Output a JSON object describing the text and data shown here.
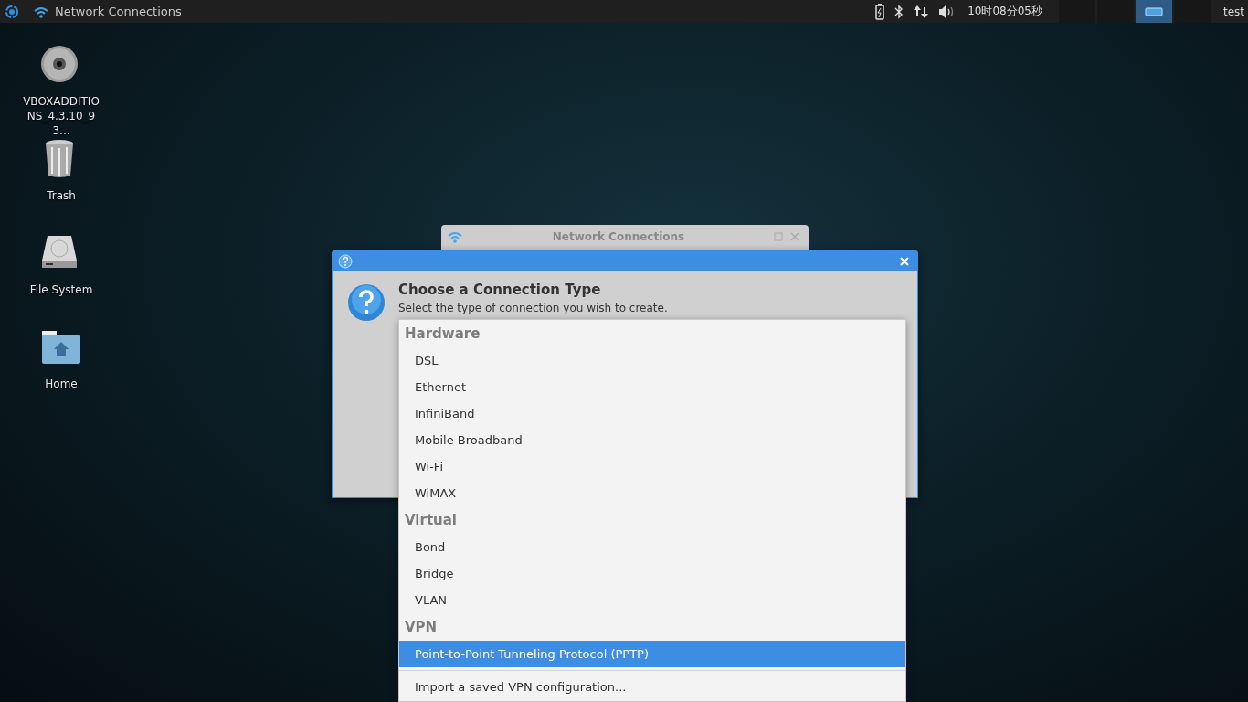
{
  "top_panel": {
    "app_title": "Network Connections",
    "clock": "10时08分05秒",
    "user": "test",
    "workspaces": [
      {
        "selected": false
      },
      {
        "selected": false
      },
      {
        "selected": true
      },
      {
        "selected": false
      }
    ]
  },
  "desktop_icons": [
    {
      "label": "VBOXADDITIONS_4.3.10_93...",
      "kind": "disc"
    },
    {
      "label": "Trash",
      "kind": "trash"
    },
    {
      "label": "File System",
      "kind": "drive"
    },
    {
      "label": "Home",
      "kind": "home"
    }
  ],
  "background_window": {
    "title": "Network Connections"
  },
  "dialog": {
    "heading": "Choose a Connection Type",
    "description": "Select the type of connection you wish to create."
  },
  "menu": {
    "groups": [
      {
        "header": "Hardware",
        "items": [
          {
            "label": "DSL",
            "selected": false
          },
          {
            "label": "Ethernet",
            "selected": false
          },
          {
            "label": "InfiniBand",
            "selected": false
          },
          {
            "label": "Mobile Broadband",
            "selected": false
          },
          {
            "label": "Wi-Fi",
            "selected": false
          },
          {
            "label": "WiMAX",
            "selected": false
          }
        ]
      },
      {
        "header": "Virtual",
        "items": [
          {
            "label": "Bond",
            "selected": false
          },
          {
            "label": "Bridge",
            "selected": false
          },
          {
            "label": "VLAN",
            "selected": false
          }
        ]
      },
      {
        "header": "VPN",
        "items": [
          {
            "label": "Point-to-Point Tunneling Protocol (PPTP)",
            "selected": true
          }
        ]
      }
    ],
    "footer_items": [
      {
        "label": "Import a saved VPN configuration...",
        "selected": false
      }
    ]
  }
}
